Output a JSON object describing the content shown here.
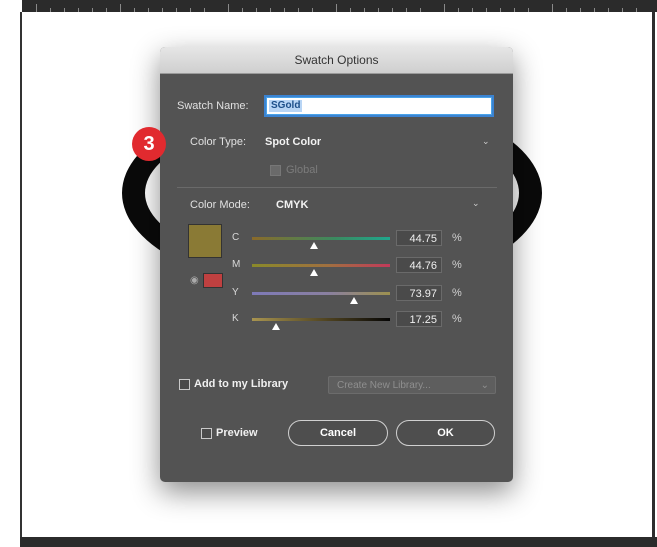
{
  "dialog": {
    "title": "Swatch Options",
    "swatch_name_label": "Swatch Name:",
    "swatch_name_value": "SGold",
    "color_type_label": "Color Type:",
    "color_type_value": "Spot Color",
    "global_label": "Global",
    "color_mode_label": "Color Mode:",
    "color_mode_value": "CMYK",
    "swatch_color": "#8a7a35",
    "channels": [
      {
        "letter": "C",
        "value": "44.75",
        "unit": "%",
        "fraction": 0.4475
      },
      {
        "letter": "M",
        "value": "44.76",
        "unit": "%",
        "fraction": 0.4476
      },
      {
        "letter": "Y",
        "value": "73.97",
        "unit": "%",
        "fraction": 0.7397
      },
      {
        "letter": "K",
        "value": "17.25",
        "unit": "%",
        "fraction": 0.1725
      }
    ],
    "add_library_label": "Add to my Library",
    "library_placeholder": "Create New Library...",
    "preview_label": "Preview",
    "cancel_label": "Cancel",
    "ok_label": "OK"
  },
  "step_badge": "3",
  "colors": {
    "dialog_bg": "#535353",
    "badge_red": "#e12a2f",
    "selection_blue": "#3b83d1"
  }
}
